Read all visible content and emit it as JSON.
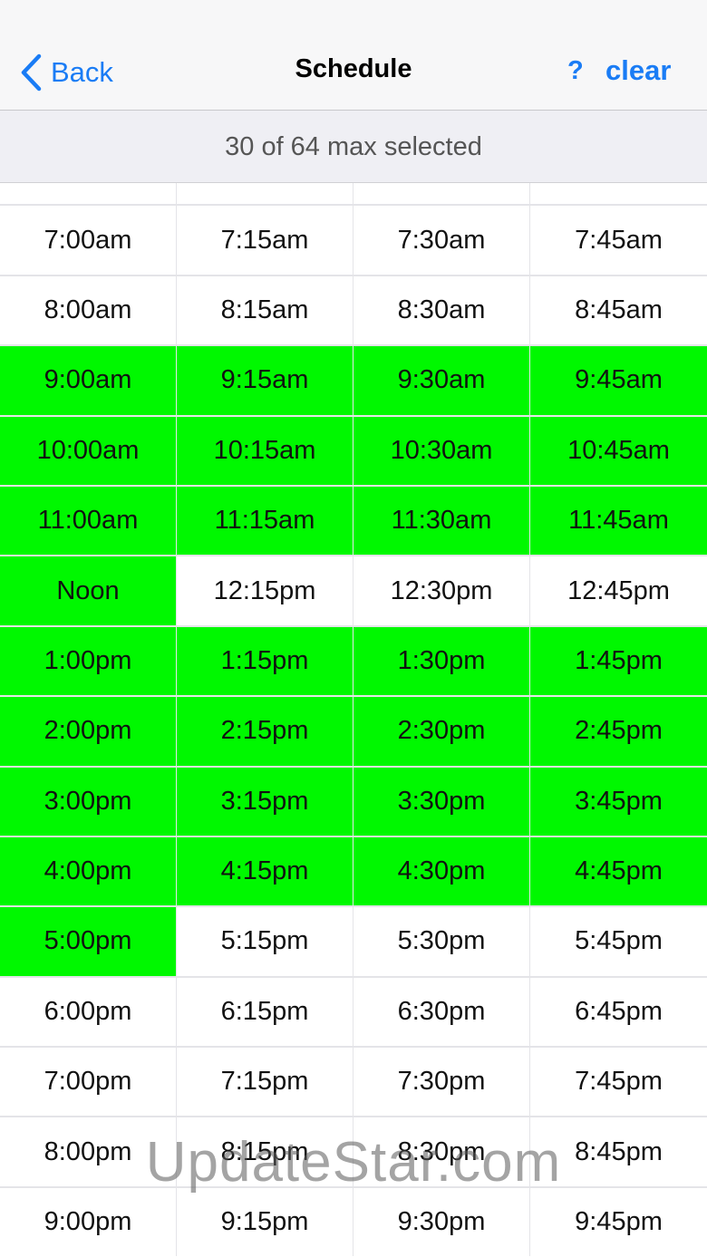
{
  "navbar": {
    "back_label": "Back",
    "back_icon": "chevron-left-icon",
    "title": "Schedule",
    "help_label": "?",
    "clear_label": "clear",
    "accent_color": "#1a7cf5"
  },
  "status": {
    "text": "30 of 64 max selected"
  },
  "colors": {
    "selected": "#00f800",
    "unselected": "#ffffff"
  },
  "rows": [
    {
      "cells": [
        {
          "label": "",
          "selected": false
        },
        {
          "label": "",
          "selected": false
        },
        {
          "label": "",
          "selected": false
        },
        {
          "label": "",
          "selected": false
        }
      ]
    },
    {
      "cells": [
        {
          "label": "7:00am",
          "selected": false
        },
        {
          "label": "7:15am",
          "selected": false
        },
        {
          "label": "7:30am",
          "selected": false
        },
        {
          "label": "7:45am",
          "selected": false
        }
      ]
    },
    {
      "cells": [
        {
          "label": "8:00am",
          "selected": false
        },
        {
          "label": "8:15am",
          "selected": false
        },
        {
          "label": "8:30am",
          "selected": false
        },
        {
          "label": "8:45am",
          "selected": false
        }
      ]
    },
    {
      "cells": [
        {
          "label": "9:00am",
          "selected": true
        },
        {
          "label": "9:15am",
          "selected": true
        },
        {
          "label": "9:30am",
          "selected": true
        },
        {
          "label": "9:45am",
          "selected": true
        }
      ]
    },
    {
      "cells": [
        {
          "label": "10:00am",
          "selected": true
        },
        {
          "label": "10:15am",
          "selected": true
        },
        {
          "label": "10:30am",
          "selected": true
        },
        {
          "label": "10:45am",
          "selected": true
        }
      ]
    },
    {
      "cells": [
        {
          "label": "11:00am",
          "selected": true
        },
        {
          "label": "11:15am",
          "selected": true
        },
        {
          "label": "11:30am",
          "selected": true
        },
        {
          "label": "11:45am",
          "selected": true
        }
      ]
    },
    {
      "cells": [
        {
          "label": "Noon",
          "selected": true
        },
        {
          "label": "12:15pm",
          "selected": false
        },
        {
          "label": "12:30pm",
          "selected": false
        },
        {
          "label": "12:45pm",
          "selected": false
        }
      ]
    },
    {
      "cells": [
        {
          "label": "1:00pm",
          "selected": true
        },
        {
          "label": "1:15pm",
          "selected": true
        },
        {
          "label": "1:30pm",
          "selected": true
        },
        {
          "label": "1:45pm",
          "selected": true
        }
      ]
    },
    {
      "cells": [
        {
          "label": "2:00pm",
          "selected": true
        },
        {
          "label": "2:15pm",
          "selected": true
        },
        {
          "label": "2:30pm",
          "selected": true
        },
        {
          "label": "2:45pm",
          "selected": true
        }
      ]
    },
    {
      "cells": [
        {
          "label": "3:00pm",
          "selected": true
        },
        {
          "label": "3:15pm",
          "selected": true
        },
        {
          "label": "3:30pm",
          "selected": true
        },
        {
          "label": "3:45pm",
          "selected": true
        }
      ]
    },
    {
      "cells": [
        {
          "label": "4:00pm",
          "selected": true
        },
        {
          "label": "4:15pm",
          "selected": true
        },
        {
          "label": "4:30pm",
          "selected": true
        },
        {
          "label": "4:45pm",
          "selected": true
        }
      ]
    },
    {
      "cells": [
        {
          "label": "5:00pm",
          "selected": true
        },
        {
          "label": "5:15pm",
          "selected": false
        },
        {
          "label": "5:30pm",
          "selected": false
        },
        {
          "label": "5:45pm",
          "selected": false
        }
      ]
    },
    {
      "cells": [
        {
          "label": "6:00pm",
          "selected": false
        },
        {
          "label": "6:15pm",
          "selected": false
        },
        {
          "label": "6:30pm",
          "selected": false
        },
        {
          "label": "6:45pm",
          "selected": false
        }
      ]
    },
    {
      "cells": [
        {
          "label": "7:00pm",
          "selected": false
        },
        {
          "label": "7:15pm",
          "selected": false
        },
        {
          "label": "7:30pm",
          "selected": false
        },
        {
          "label": "7:45pm",
          "selected": false
        }
      ]
    },
    {
      "cells": [
        {
          "label": "8:00pm",
          "selected": false
        },
        {
          "label": "8:15pm",
          "selected": false
        },
        {
          "label": "8:30pm",
          "selected": false
        },
        {
          "label": "8:45pm",
          "selected": false
        }
      ]
    },
    {
      "cells": [
        {
          "label": "9:00pm",
          "selected": false
        },
        {
          "label": "9:15pm",
          "selected": false
        },
        {
          "label": "9:30pm",
          "selected": false
        },
        {
          "label": "9:45pm",
          "selected": false
        }
      ]
    }
  ],
  "watermark": "UpdateStar.com"
}
